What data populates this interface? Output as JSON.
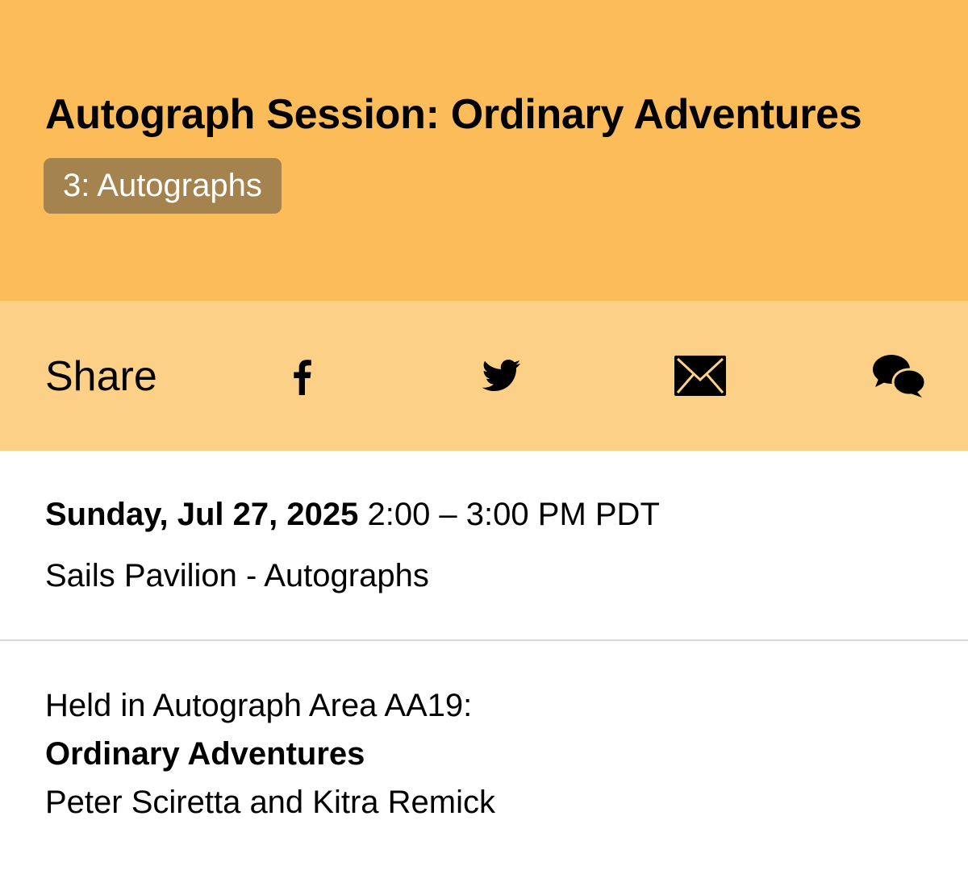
{
  "event": {
    "title": "Autograph Session: Ordinary Adventures",
    "track_badge": "3: Autographs"
  },
  "share": {
    "label": "Share",
    "icons": [
      "facebook-icon",
      "twitter-icon",
      "email-icon",
      "chat-icon"
    ]
  },
  "schedule": {
    "date": "Sunday, Jul 27, 2025",
    "time": "2:00 – 3:00 PM PDT",
    "location": "Sails Pavilion - Autographs"
  },
  "description": {
    "line1": "Held in Autograph Area AA19:",
    "line2": "Ordinary Adventures",
    "line3": "Peter Sciretta and Kitra Remick"
  },
  "colors": {
    "header_bg": "#FDBC5A",
    "share_bg": "#FDD088",
    "badge_bg": "#A5834E",
    "divider": "#D9D9D9"
  }
}
